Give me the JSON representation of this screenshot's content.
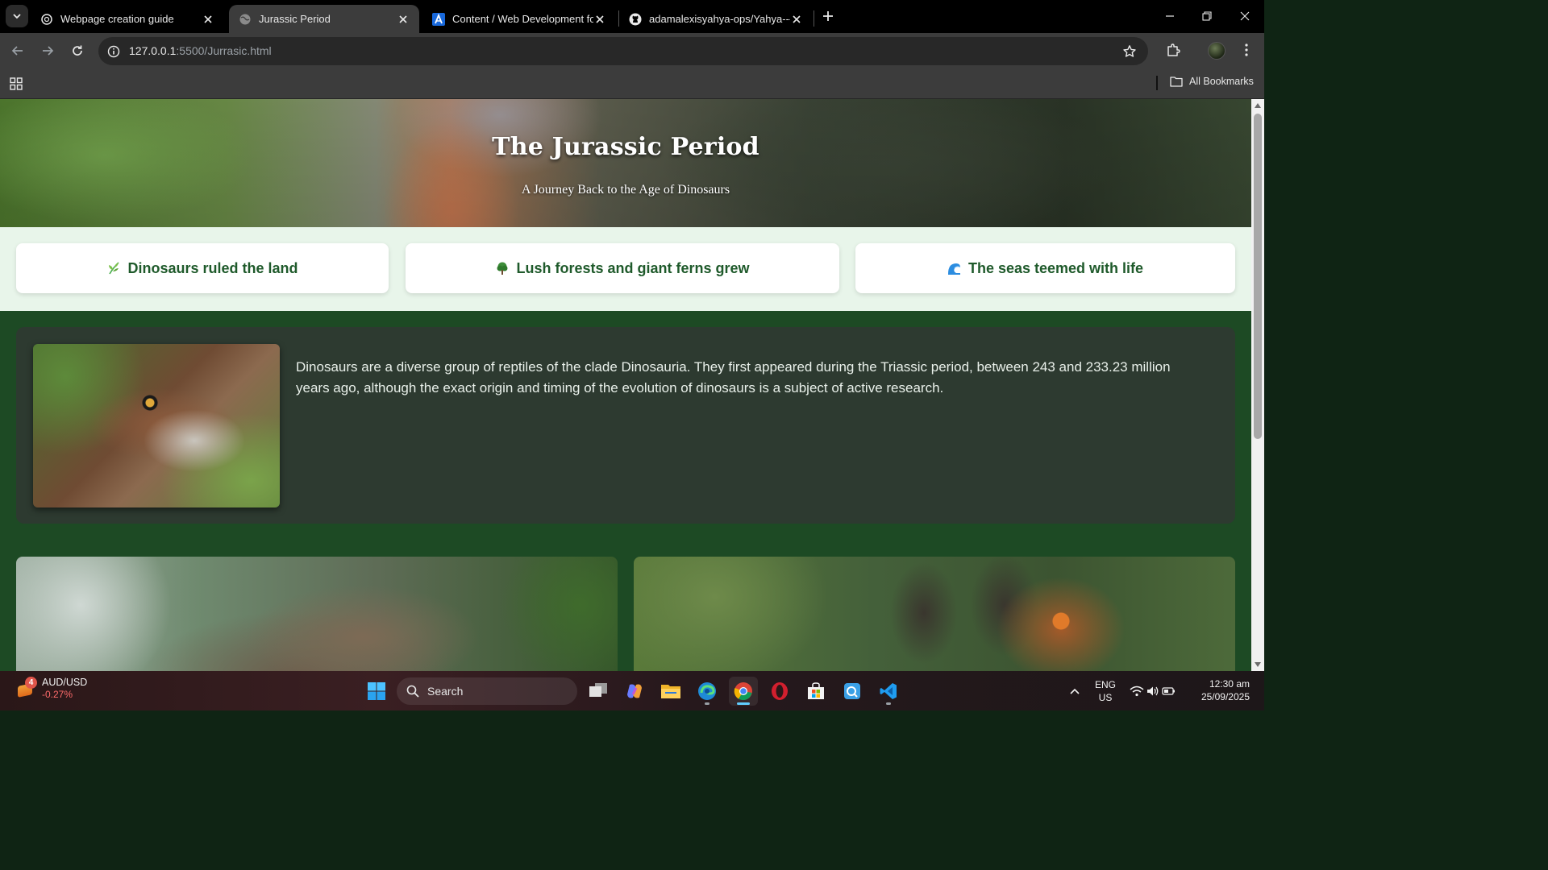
{
  "browser": {
    "tabs": [
      {
        "title": "Webpage creation guide",
        "icon": "chatgpt-icon",
        "active": false
      },
      {
        "title": "Jurassic Period",
        "icon": "globe-icon",
        "active": true
      },
      {
        "title": "Content / Web Development fo",
        "icon": "atlassian-icon",
        "active": false
      },
      {
        "title": "adamalexisyahya-ops/Yahya---F",
        "icon": "github-icon",
        "active": false
      }
    ],
    "url_host": "127.0.0.1",
    "url_rest": ":5500/Jurrasic.html",
    "bookmarks_label": "All Bookmarks"
  },
  "page": {
    "hero": {
      "title": "The Jurassic Period",
      "subtitle": "A Journey Back to the Age of Dinosaurs"
    },
    "facts": [
      {
        "icon": "leaf-icon",
        "emoji": "🌿",
        "label": "Dinosaurs ruled the land"
      },
      {
        "icon": "tree-icon",
        "emoji": "🌳",
        "label": "Lush forests and giant ferns grew"
      },
      {
        "icon": "wave-icon",
        "emoji": "🌊",
        "label": "The seas teemed with life"
      }
    ],
    "intro": {
      "text": "Dinosaurs are a diverse group of reptiles of the clade Dinosauria. They first appeared during the Triassic period, between 243 and 233.23 million years ago, although the exact origin and timing of the evolution of dinosaurs is a subject of active research."
    }
  },
  "taskbar": {
    "widget": {
      "symbol": "AUD/USD",
      "change": "-0.27%",
      "badge": "4"
    },
    "search_label": "Search",
    "language": {
      "line1": "ENG",
      "line2": "US"
    },
    "clock": {
      "time": "12:30 am",
      "date": "25/09/2025"
    }
  },
  "colors": {
    "fact_text": "#1f5a2b",
    "page_bg": "#1d4a24",
    "intro_card": "#2d3a30",
    "facts_band": "#e8f5ea"
  }
}
